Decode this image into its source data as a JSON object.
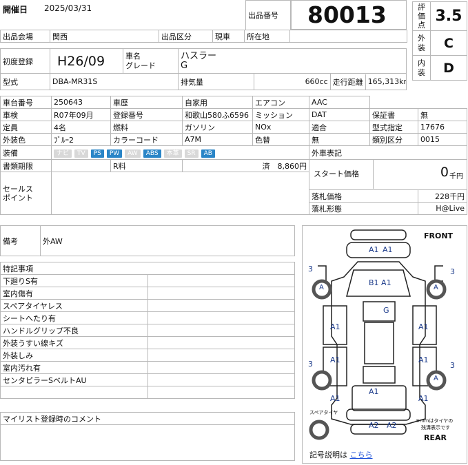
{
  "header": {
    "date_label": "開催日",
    "date_value": "2025/03/31",
    "lot_label": "出品番号",
    "lot_value": "80013",
    "venue_label": "出品会場",
    "venue_value": "関西",
    "category_label": "出品区分",
    "category_value": "現車",
    "location_label": "所在地",
    "location_value": ""
  },
  "evaluation": {
    "score_label": "評価点",
    "score_value": "3.5",
    "exterior_label": "外装",
    "exterior_value": "C",
    "interior_label": "内装",
    "interior_value": "D"
  },
  "vehicle": {
    "first_reg_label": "初度登録",
    "first_reg_value": "H26/09",
    "name_label": "車名",
    "grade_label": "グレード",
    "name_value": "ハスラー",
    "grade_value": "G",
    "model_label": "型式",
    "model_value": "DBA-MR31S",
    "displacement_label": "排気量",
    "displacement_value": "660cc",
    "mileage_label": "走行距離",
    "mileage_value": "165,313km"
  },
  "details": {
    "r1": [
      "車台番号",
      "250643",
      "車歴",
      "自家用",
      "エアコン",
      "AAC"
    ],
    "r2": [
      "車検",
      "R07年09月",
      "登録番号",
      "和歌山580ふ6596",
      "ミッション",
      "DAT",
      "保証書",
      "無"
    ],
    "r3": [
      "定員",
      "4名",
      "燃料",
      "ガソリン",
      "NOx",
      "適合",
      "型式指定",
      "17676"
    ],
    "r4": [
      "外装色",
      "ﾌﾞﾙｰ2",
      "カラーコード",
      "A7M",
      "色替",
      "無",
      "類別区分",
      "0015"
    ],
    "equip_label": "装備",
    "equipment": [
      {
        "label": "ナビ",
        "on": false
      },
      {
        "label": "TV",
        "on": false
      },
      {
        "label": "PS",
        "on": true
      },
      {
        "label": "PW",
        "on": true
      },
      {
        "label": "AW",
        "on": false
      },
      {
        "label": "ABS",
        "on": true
      },
      {
        "label": "本革",
        "on": false
      },
      {
        "label": "SR",
        "on": false
      },
      {
        "label": "AB",
        "on": true
      }
    ],
    "docs_label": "書類期限",
    "recycle_label": "R料",
    "recycle_value": "済　8,860円",
    "sales_label_1": "セールス",
    "sales_label_2": "ポイント"
  },
  "pricing": {
    "foreign_label": "外車表記",
    "start_label": "スタート価格",
    "start_value": "0",
    "start_unit": "千円",
    "winning_label": "落札価格",
    "winning_value": "228千円",
    "form_label": "落札形態",
    "form_value": "H@Live"
  },
  "notes": {
    "remarks_label": "備考",
    "remarks_value": "外AW",
    "special_label": "特記事項",
    "special_items": [
      "下廻りS有",
      "室内傷有",
      "スペアタイヤレス",
      "シートへたり有",
      "ハンドルグリップ不良",
      "外装うすい線キズ",
      "外装しみ",
      "室内汚れ有",
      "センタピラーSベルトAU"
    ],
    "comment_label": "マイリスト登録時のコメント"
  },
  "diagram": {
    "front_label": "FRONT",
    "rear_label": "REAR",
    "spare_label": "スペアタイヤ",
    "tire_note_1": "※mmはタイヤの",
    "tire_note_2": "残溝表示です",
    "legend_text": "記号説明は",
    "legend_link": "こちら",
    "marks": {
      "front_a1a": "A1",
      "front_a1b": "A1",
      "hood": "B1 A1",
      "roof": "G",
      "left_front_door": "A1",
      "left_rear_door": "A1",
      "left_rear": "A1",
      "right_front_door": "A1",
      "right_rear_door": "A1",
      "right_rear": "A1",
      "trunk": "A1",
      "rear_a2a": "A2",
      "rear_a2b": "A2",
      "tire_fl": "3",
      "tire_fr": "3",
      "tire_rl": "3",
      "tire_rr": "3",
      "wheel_a": "A"
    }
  }
}
